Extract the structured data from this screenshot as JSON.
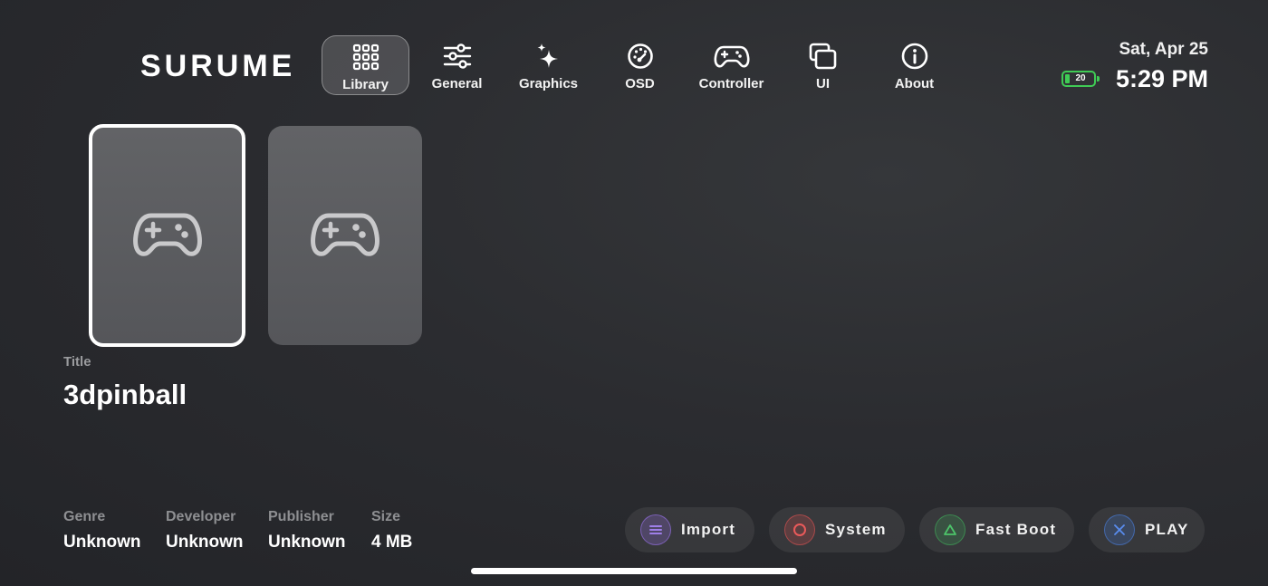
{
  "app": {
    "brand": "SURUME"
  },
  "nav": {
    "items": [
      {
        "label": "Library",
        "icon": "grid-icon",
        "active": true
      },
      {
        "label": "General",
        "icon": "sliders-icon",
        "active": false
      },
      {
        "label": "Graphics",
        "icon": "sparkles-icon",
        "active": false
      },
      {
        "label": "OSD",
        "icon": "gauge-icon",
        "active": false
      },
      {
        "label": "Controller",
        "icon": "gamepad-icon",
        "active": false
      },
      {
        "label": "UI",
        "icon": "windows-icon",
        "active": false
      },
      {
        "label": "About",
        "icon": "info-icon",
        "active": false
      }
    ]
  },
  "status": {
    "date": "Sat, Apr 25",
    "time": "5:29 PM",
    "battery_level": "20",
    "battery_color": "#3fcb55"
  },
  "library": {
    "cards": [
      {
        "icon": "gamepad-icon",
        "selected": true
      },
      {
        "icon": "gamepad-icon",
        "selected": false
      }
    ]
  },
  "selected_game": {
    "title_label": "Title",
    "title": "3dpinball",
    "meta": [
      {
        "label": "Genre",
        "value": "Unknown"
      },
      {
        "label": "Developer",
        "value": "Unknown"
      },
      {
        "label": "Publisher",
        "value": "Unknown"
      },
      {
        "label": "Size",
        "value": "4 MB"
      }
    ]
  },
  "actions": [
    {
      "label": "Import",
      "icon": "menu-icon",
      "color": "#8e6bd8"
    },
    {
      "label": "System",
      "icon": "circle-icon",
      "color": "#e05252"
    },
    {
      "label": "Fast Boot",
      "icon": "triangle-icon",
      "color": "#3fae5a"
    },
    {
      "label": "PLAY",
      "icon": "cross-icon",
      "color": "#4a7fe0"
    }
  ]
}
